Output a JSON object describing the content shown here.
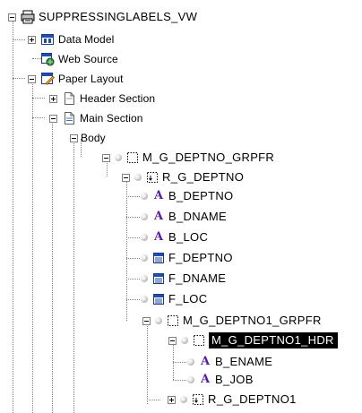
{
  "tree": {
    "root_label": "SUPPRESSINGLABELS_VW",
    "data_model_label": "Data Model",
    "web_source_label": "Web Source",
    "paper_layout_label": "Paper Layout",
    "header_section_label": "Header Section",
    "main_section_label": "Main Section",
    "body_label": "Body",
    "m_g_deptno_grpfr_label": "M_G_DEPTNO_GRPFR",
    "r_g_deptno_label": "R_G_DEPTNO",
    "b_deptno_label": "B_DEPTNO",
    "b_dname_label": "B_DNAME",
    "b_loc_label": "B_LOC",
    "f_deptno_label": "F_DEPTNO",
    "f_dname_label": "F_DNAME",
    "f_loc_label": "F_LOC",
    "m_g_deptno1_grpfr_label": "M_G_DEPTNO1_GRPFR",
    "m_g_deptno1_hdr_label": "M_G_DEPTNO1_HDR",
    "b_ename_label": "B_ENAME",
    "b_job_label": "B_JOB",
    "r_g_deptno1_label": "R_G_DEPTNO1"
  },
  "selected_node": "M_G_DEPTNO1_HDR",
  "icons": {
    "report": "report-icon",
    "data_model": "data-model-icon",
    "web_source": "web-source-icon",
    "paper_layout": "paper-layout-icon",
    "section": "section-icon",
    "frame": "frame-icon",
    "repeating_frame": "repeating-frame-icon",
    "boilerplate_text": "boilerplate-text-icon",
    "field": "field-icon"
  },
  "colors": {
    "selection_background": "#000000",
    "selection_text": "#ffffff",
    "boilerplate_letter": "#5b1aa8"
  }
}
